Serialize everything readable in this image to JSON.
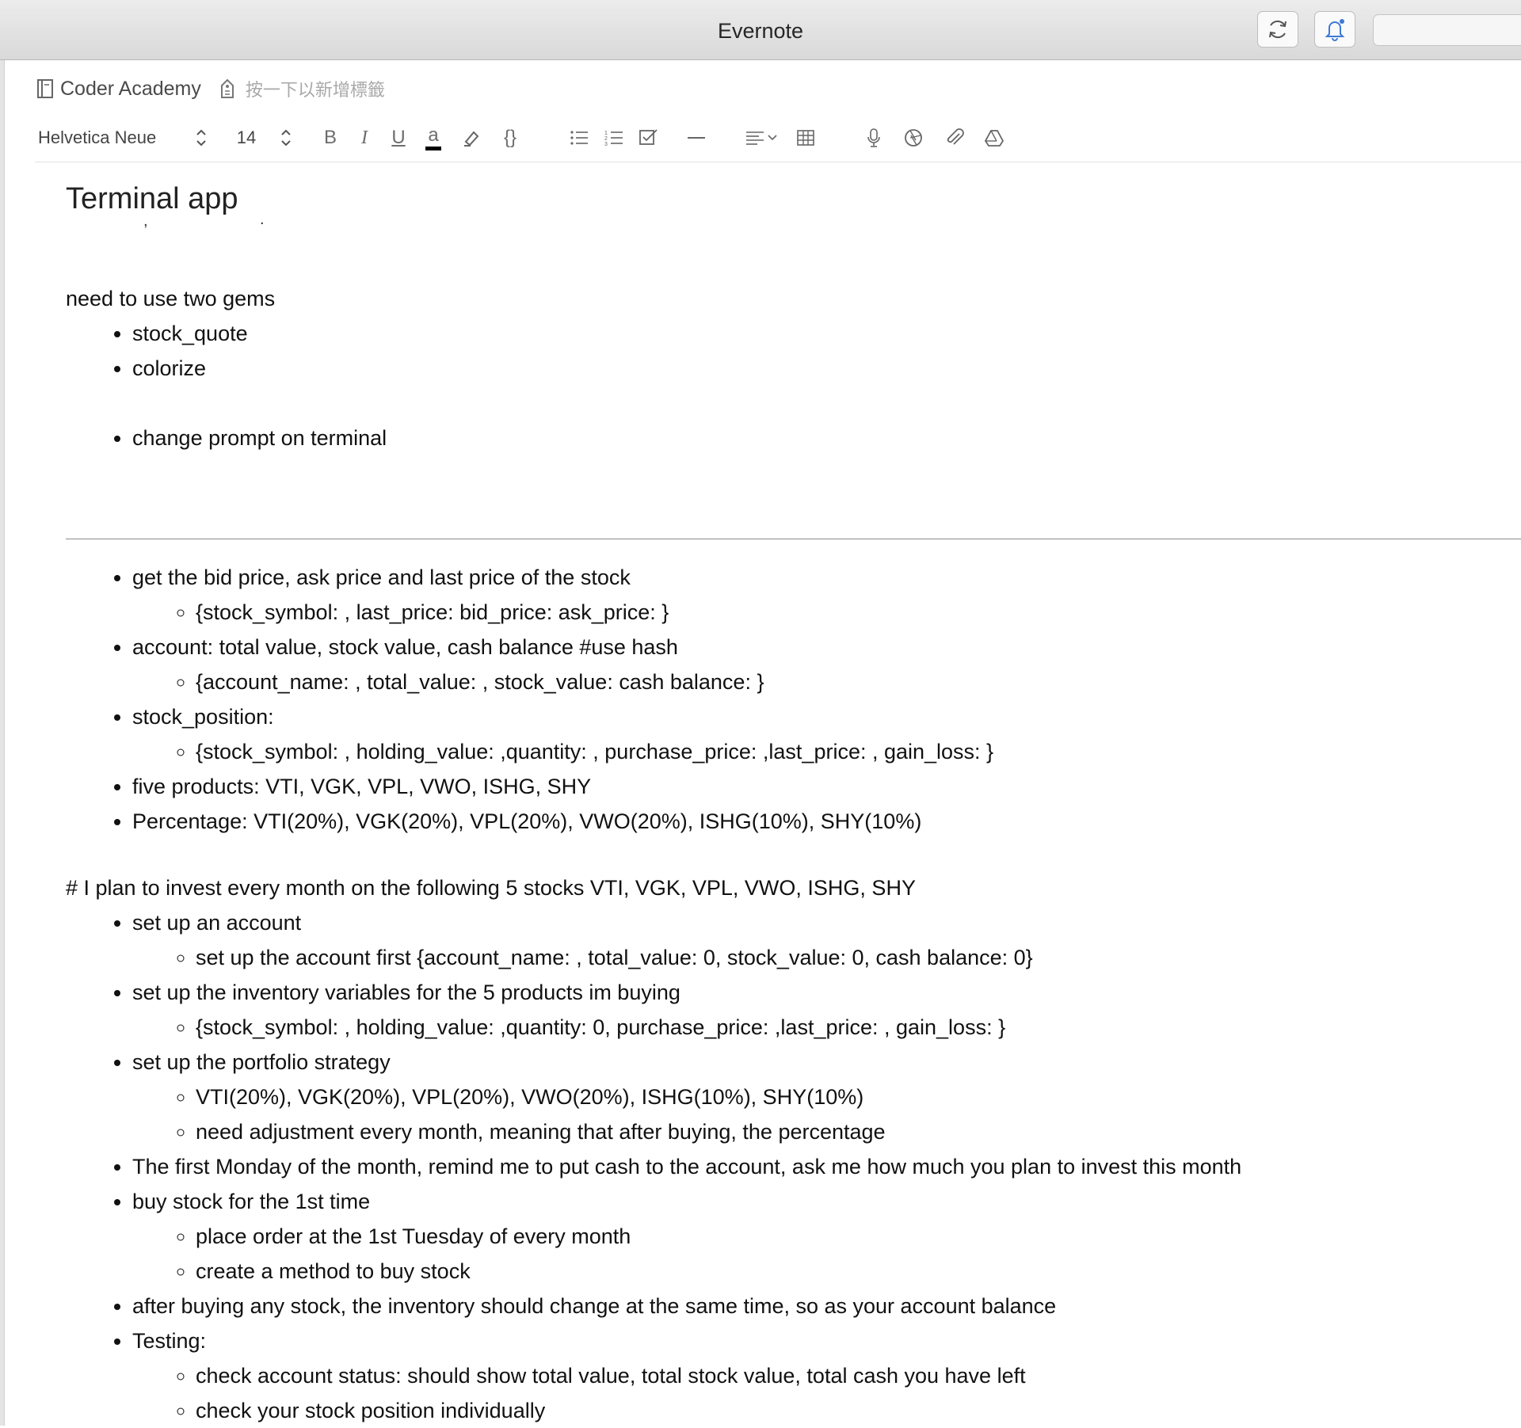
{
  "window": {
    "title": "Evernote"
  },
  "toolbar_buttons": {
    "sync_icon": "sync-icon",
    "activity_icon": "bell-icon"
  },
  "note_header": {
    "notebook_name": "Coder Academy",
    "tag_placeholder": "按一下以新增標籤"
  },
  "format_bar": {
    "font_family": "Helvetica Neue",
    "font_size": "14",
    "bold": "B",
    "italic": "I",
    "underline": "U",
    "text_color": "a",
    "code_block": "{}",
    "icons": [
      "highlighter-icon",
      "bulleted-list-icon",
      "numbered-list-icon",
      "checkbox-icon",
      "horizontal-rule-icon",
      "align-icon",
      "table-icon",
      "microphone-icon",
      "camera-icon",
      "attachment-icon",
      "google-drive-icon"
    ]
  },
  "note": {
    "title": "Terminal app",
    "section1": {
      "intro": "need to use two gems",
      "gems": [
        "stock_quote",
        "colorize"
      ],
      "extra": "change prompt on terminal"
    },
    "section2": {
      "items": [
        {
          "text": "get the bid price, ask price and last price of the stock",
          "sub": [
            "{stock_symbol: , last_price: bid_price: ask_price: }"
          ]
        },
        {
          "text": "account: total value, stock value, cash balance #use hash",
          "sub": [
            "{account_name: , total_value: , stock_value: cash balance: }"
          ]
        },
        {
          "text": "stock_position:",
          "sub": [
            "{stock_symbol: , holding_value: ,quantity: , purchase_price: ,last_price: , gain_loss: }"
          ]
        },
        {
          "text": "five products: VTI, VGK, VPL, VWO, ISHG, SHY"
        },
        {
          "text": "Percentage: VTI(20%), VGK(20%), VPL(20%), VWO(20%), ISHG(10%), SHY(10%)"
        }
      ]
    },
    "section3": {
      "heading": "# I plan to invest every month on the following 5 stocks  VTI, VGK, VPL, VWO, ISHG, SHY",
      "items": [
        {
          "text": "set up an account",
          "sub": [
            "set up the account first {account_name: , total_value: 0, stock_value: 0, cash balance: 0}"
          ]
        },
        {
          "text": "set up the inventory variables for the 5 products im buying",
          "sub": [
            "{stock_symbol: , holding_value: ,quantity: 0, purchase_price: ,last_price: , gain_loss: }"
          ]
        },
        {
          "text": "set up the portfolio strategy",
          "sub": [
            "VTI(20%), VGK(20%), VPL(20%), VWO(20%), ISHG(10%), SHY(10%)",
            "need adjustment every month, meaning that after buying, the percentage"
          ]
        },
        {
          "text": "The first Monday of the month, remind me to put cash to the account, ask me how much you plan to invest this month"
        },
        {
          "text": "buy stock for the 1st time",
          "sub": [
            "place order at the 1st Tuesday of every month",
            "create a method to buy stock"
          ]
        },
        {
          "text": "after buying any stock, the inventory should change at the same time, so as your account balance"
        },
        {
          "text": "Testing:",
          "sub": [
            "check account status: should show total value, total stock value, total cash you have left",
            "check your stock position individually"
          ]
        }
      ]
    }
  }
}
